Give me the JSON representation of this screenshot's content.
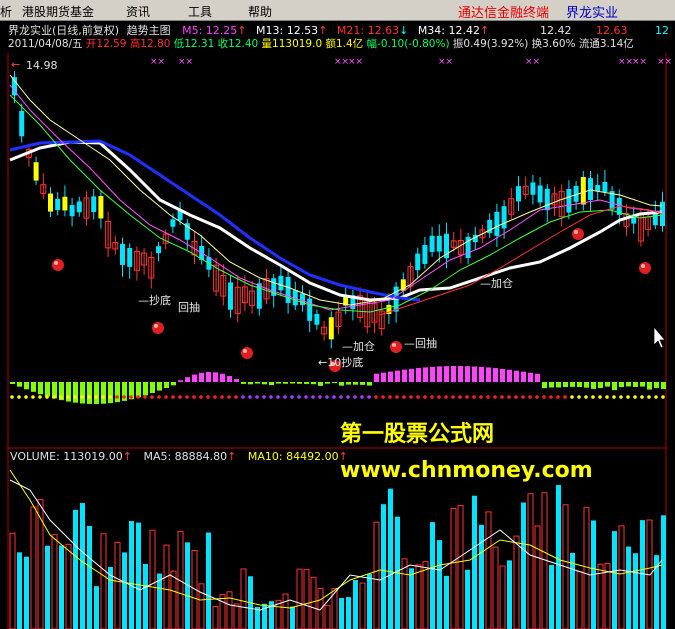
{
  "menu": {
    "items": [
      "析",
      "港股期货基金",
      "资讯",
      "工具",
      "帮助"
    ],
    "brand_left": "通达信金融终端",
    "brand_right": "界龙实业"
  },
  "header1": {
    "stock": "界龙实业(日线,前复权)",
    "indicator": "趋势主图",
    "m5": "M5: 12.25",
    "m13": "M13: 12.53",
    "m21": "M21: 12.63",
    "m34": "M34: 12.42"
  },
  "header2": {
    "date": "2011/04/08/五",
    "open": "开12.59",
    "high": "高12.80",
    "low": "低12.31",
    "close": "收12.40",
    "volume": "量113019.0",
    "amount": "额1.4亿",
    "change": "幅-0.10(-0.80%)",
    "amplitude": "振0.49(3.92%)",
    "turnover": "换3.60%",
    "float": "流通3.14亿"
  },
  "price_high_label": "14.98",
  "price_right_labels": [
    "12.42",
    "12.63",
    "12"
  ],
  "annotations": {
    "chaodi1": "抄底",
    "huichou1": "回抽",
    "jiacang1": "加仓",
    "chaodi2": "抄底",
    "huichou2": "回抽",
    "jiacang2": "加仓",
    "low_mark": "10"
  },
  "volume_header": {
    "volume": "VOLUME: 113019.00",
    "ma5": "MA5: 88884.80",
    "ma10": "MA10: 84492.00"
  },
  "watermark": {
    "title": "第一股票公式网",
    "url": "www.chnmoney.com"
  },
  "colors": {
    "up": "#ff3232",
    "down": "#00e4ff",
    "ma_white": "#ffffff",
    "ma_blue": "#2030ff",
    "ma_yellow": "#ffff00",
    "magenta": "#ff44ff",
    "green": "#80ff00"
  }
}
